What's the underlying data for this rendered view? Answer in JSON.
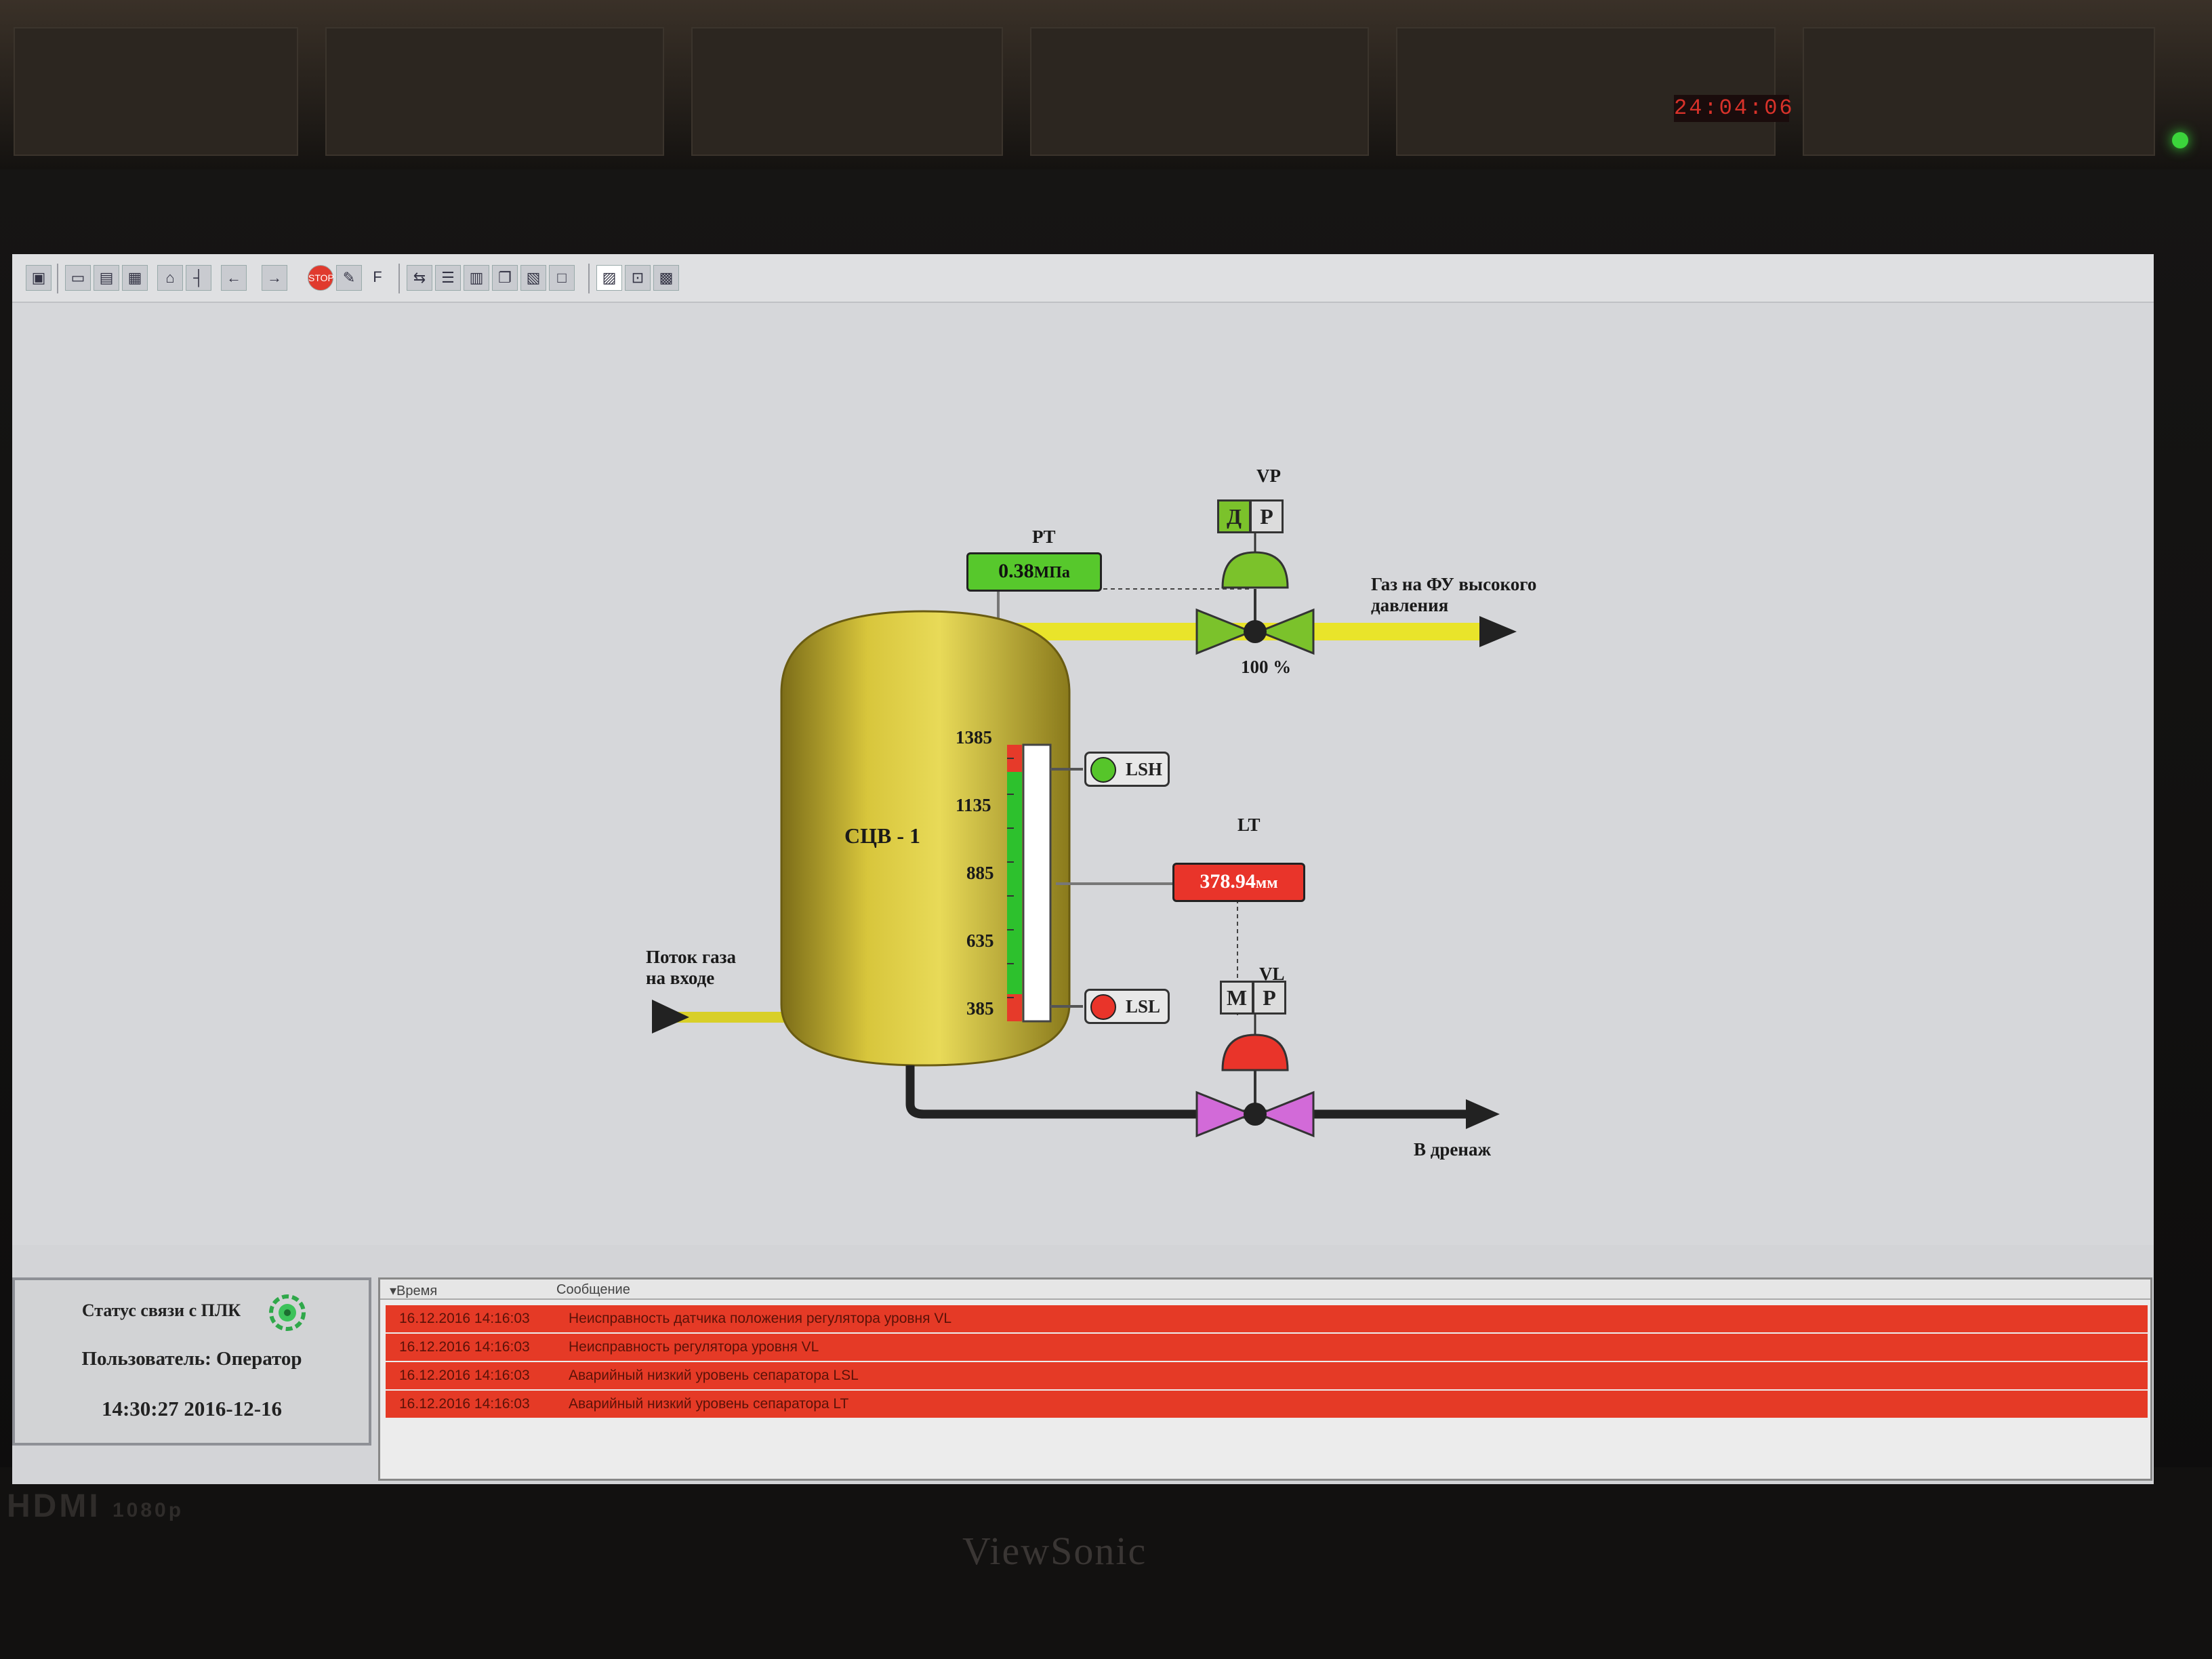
{
  "colors": {
    "pipe_yellow": "#e9e42a",
    "valve_green": "#7bc22b",
    "valve_magenta": "#d26ad8",
    "alarm_red": "#e53a26",
    "ok_green": "#57c82c",
    "tank_gold": "#c8b532"
  },
  "environment": {
    "led_readout": "24:04:06",
    "monitor_brand": "ViewSonic",
    "port_label": "HDMI",
    "res_label": "1080p"
  },
  "toolbar": {
    "icons": [
      "monitor-icon",
      "window-icon",
      "window2-icon",
      "grid-icon",
      "home-icon",
      "tree-icon",
      "back-icon",
      "forward-icon",
      "stop-icon",
      "edit-icon",
      "f-icon",
      "nav-icon",
      "list-icon",
      "report-icon",
      "copy-icon",
      "trend-icon",
      "blank-icon",
      "user-panel-icon",
      "chart-icon",
      "image-icon"
    ],
    "stop_label": "STOP",
    "f_label": "F"
  },
  "scheme": {
    "tank_name": "СЦВ - 1",
    "inlet_label_1": "Поток газа",
    "inlet_label_2": "на входе",
    "outlet_label_1": "Газ на ФУ высокого",
    "outlet_label_2": "давления",
    "drain_label": "В дренаж",
    "pt": {
      "tag": "PT",
      "value": "0.38",
      "unit": "МПа"
    },
    "vp": {
      "tag": "VP",
      "mode_1": "Д",
      "mode_2": "Р",
      "position": "100 %"
    },
    "lt": {
      "tag": "LT",
      "value": "378.94",
      "unit": "мм"
    },
    "vl": {
      "tag": "VL",
      "mode_1": "М",
      "mode_2": "Р"
    },
    "lsh": {
      "tag": "LSH",
      "state_color": "#56c52a"
    },
    "lsl": {
      "tag": "LSL",
      "state_color": "#e9342a"
    },
    "level_scale": [
      "1385",
      "1135",
      "885",
      "635",
      "385"
    ],
    "level_fraction": 0.0
  },
  "status_panel": {
    "plc_label": "Статус связи с ПЛК",
    "user_label": "Пользователь: Оператор",
    "datetime": "14:30:27 2016-12-16"
  },
  "alarms": {
    "col_time": "Время",
    "col_message": "Сообщение",
    "rows": [
      {
        "time": "16.12.2016 14:16:03",
        "message": "Неисправность датчика положения регулятора уровня VL"
      },
      {
        "time": "16.12.2016 14:16:03",
        "message": "Неисправность регулятора уровня VL"
      },
      {
        "time": "16.12.2016 14:16:03",
        "message": "Аварийный низкий уровень сепаратора LSL"
      },
      {
        "time": "16.12.2016 14:16:03",
        "message": "Аварийный низкий уровень сепаратора LT"
      }
    ]
  }
}
